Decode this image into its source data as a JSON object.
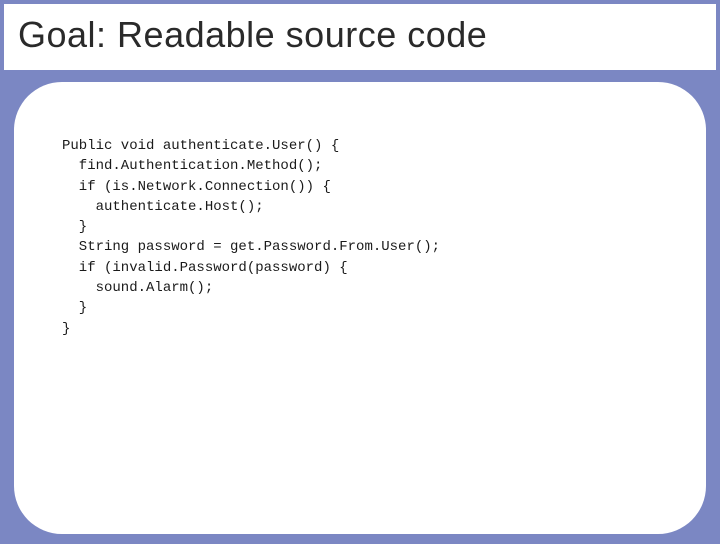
{
  "slide": {
    "title": "Goal: Readable source code",
    "code_lines": [
      "Public void authenticate.User() {",
      "  find.Authentication.Method();",
      "  if (is.Network.Connection()) {",
      "    authenticate.Host();",
      "  }",
      "  String password = get.Password.From.User();",
      "  if (invalid.Password(password) {",
      "    sound.Alarm();",
      "  }",
      "}"
    ]
  }
}
